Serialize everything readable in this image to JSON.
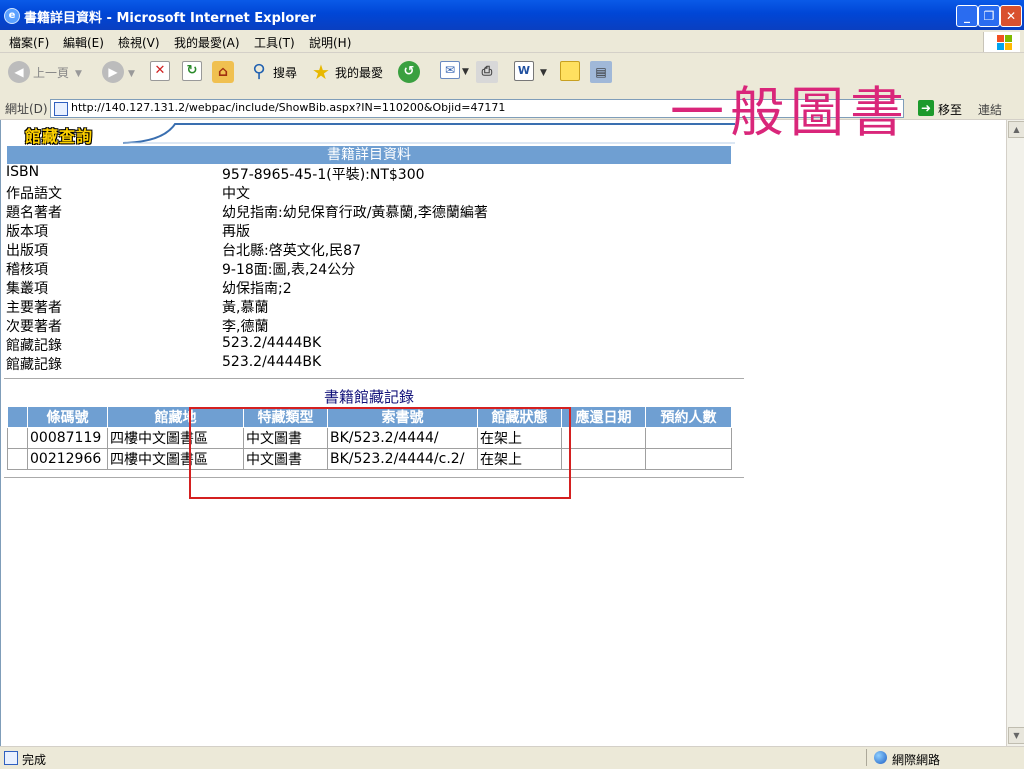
{
  "window": {
    "title": "書籍詳目資料 - Microsoft Internet Explorer",
    "min_glyph": "_",
    "max_glyph": "❐",
    "close_glyph": "✕"
  },
  "menu": [
    "檔案(F)",
    "編輯(E)",
    "檢視(V)",
    "我的最愛(A)",
    "工具(T)",
    "說明(H)"
  ],
  "toolbar": {
    "back_label": "上一頁",
    "search_label": "搜尋",
    "favorites_label": "我的最愛"
  },
  "address": {
    "label": "網址(D)",
    "url": "http://140.127.131.2/webpac/include/ShowBib.aspx?IN=110200&Objid=47171",
    "go_label": "移至",
    "links_label": "連結"
  },
  "page": {
    "logo_text": "館藏查詢",
    "header": "書籍詳目資料",
    "fields": [
      {
        "label": "ISBN",
        "value": "957-8965-45-1(平裝):NT$300"
      },
      {
        "label": "作品語文",
        "value": "中文"
      },
      {
        "label": "題名著者",
        "value": "幼兒指南:幼兒保育行政/黃慕蘭,李德蘭編著"
      },
      {
        "label": "版本項",
        "value": "再版"
      },
      {
        "label": "出版項",
        "value": "台北縣:啓英文化,民87"
      },
      {
        "label": "稽核項",
        "value": "9-18面:圖,表,24公分"
      },
      {
        "label": "集叢項",
        "value": "幼保指南;2"
      },
      {
        "label": "主要著者",
        "value": "黃,慕蘭"
      },
      {
        "label": "次要著者",
        "value": "李,德蘭"
      },
      {
        "label": "館藏記錄",
        "value": "523.2/4444BK"
      },
      {
        "label": "館藏記錄",
        "value": "523.2/4444BK"
      }
    ],
    "holdings_title": "書籍館藏記錄",
    "holdings_columns": [
      "條碼號",
      "館藏地",
      "特藏類型",
      "索書號",
      "館藏狀態",
      "應還日期",
      "預約人數"
    ],
    "holdings_rows": [
      [
        "00087119",
        "四樓中文圖書區",
        "中文圖書",
        "BK/523.2/4444/",
        "在架上",
        "",
        ""
      ],
      [
        "00212966",
        "四樓中文圖書區",
        "中文圖書",
        "BK/523.2/4444/c.2/",
        "在架上",
        "",
        ""
      ]
    ]
  },
  "annotation": {
    "handwritten_note": "一般圖書",
    "highlight_color": "#d42020",
    "note_color": "#d9267a"
  },
  "status": {
    "text": "完成",
    "zone": "網際網路"
  },
  "colors": {
    "titlebar": "#0046d6",
    "header_bar": "#6f9fd2",
    "holdings_title": "#12127a"
  }
}
